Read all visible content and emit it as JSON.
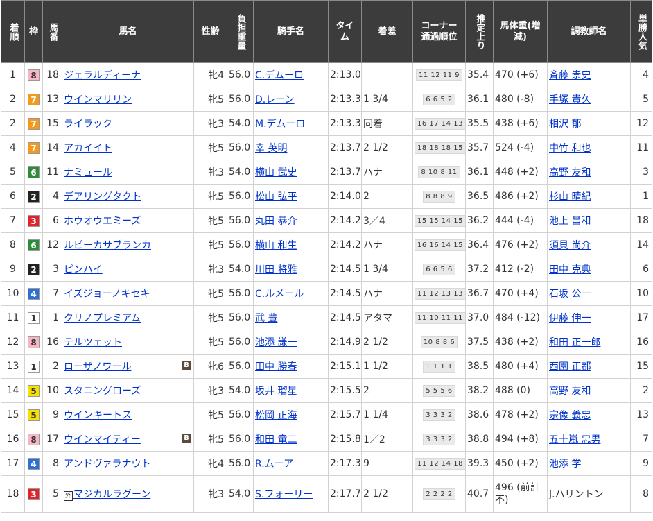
{
  "headers": {
    "rank": "着順",
    "waku": "枠",
    "umaban": "馬番",
    "horse": "馬名",
    "sexage": "性齢",
    "weight": "負担重量",
    "jockey": "騎手名",
    "time": "タイム",
    "margin": "着差",
    "corner": "コーナー通過順位",
    "last3f": "推定上り",
    "bodyweight": "馬体重(増減)",
    "trainer": "調教師名",
    "popularity": "単勝人気"
  },
  "waku_colors": {
    "1": {
      "bg": "#ffffff",
      "fg": "#333333"
    },
    "2": {
      "bg": "#222222",
      "fg": "#ffffff"
    },
    "3": {
      "bg": "#e0242a",
      "fg": "#ffffff"
    },
    "4": {
      "bg": "#2c6fd6",
      "fg": "#ffffff"
    },
    "5": {
      "bg": "#f5e000",
      "fg": "#333333"
    },
    "6": {
      "bg": "#2e8b3a",
      "fg": "#ffffff"
    },
    "7": {
      "bg": "#f39a1e",
      "fg": "#ffffff"
    },
    "8": {
      "bg": "#f6b6c6",
      "fg": "#333333"
    }
  },
  "rows": [
    {
      "rank": "1",
      "waku": "8",
      "umaban": "18",
      "horse": "ジェラルディーナ",
      "blinker": false,
      "ext": false,
      "sexage": "牝4",
      "weight": "56.0",
      "jockey": "C.デムーロ",
      "time": "2:13.0",
      "margin": "",
      "corner": "11 12 11 9",
      "last3f": "35.4",
      "bodyweight": "470 (+6)",
      "trainer": "斉藤 崇史",
      "trainer_link": true,
      "popularity": "4"
    },
    {
      "rank": "2",
      "waku": "7",
      "umaban": "13",
      "horse": "ウインマリリン",
      "blinker": false,
      "ext": false,
      "sexage": "牝5",
      "weight": "56.0",
      "jockey": "D.レーン",
      "time": "2:13.3",
      "margin": "1 3/4",
      "corner": "6 6 5 2",
      "last3f": "36.1",
      "bodyweight": "480 (-8)",
      "trainer": "手塚 貴久",
      "trainer_link": true,
      "popularity": "5"
    },
    {
      "rank": "2",
      "waku": "7",
      "umaban": "15",
      "horse": "ライラック",
      "blinker": false,
      "ext": false,
      "sexage": "牝3",
      "weight": "54.0",
      "jockey": "M.デムーロ",
      "time": "2:13.3",
      "margin": "同着",
      "corner": "16 17 14 13",
      "last3f": "35.5",
      "bodyweight": "438 (+6)",
      "trainer": "相沢 郁",
      "trainer_link": true,
      "popularity": "12"
    },
    {
      "rank": "4",
      "waku": "7",
      "umaban": "14",
      "horse": "アカイイト",
      "blinker": false,
      "ext": false,
      "sexage": "牝5",
      "weight": "56.0",
      "jockey": "幸 英明",
      "time": "2:13.7",
      "margin": "2 1/2",
      "corner": "18 18 18 15",
      "last3f": "35.7",
      "bodyweight": "524 (-4)",
      "trainer": "中竹 和也",
      "trainer_link": true,
      "popularity": "11"
    },
    {
      "rank": "5",
      "waku": "6",
      "umaban": "11",
      "horse": "ナミュール",
      "blinker": false,
      "ext": false,
      "sexage": "牝3",
      "weight": "54.0",
      "jockey": "横山 武史",
      "time": "2:13.7",
      "margin": "ハナ",
      "corner": "8 10 8 11",
      "last3f": "36.1",
      "bodyweight": "448 (+2)",
      "trainer": "高野 友和",
      "trainer_link": true,
      "popularity": "3"
    },
    {
      "rank": "6",
      "waku": "2",
      "umaban": "4",
      "horse": "デアリングタクト",
      "blinker": false,
      "ext": false,
      "sexage": "牝5",
      "weight": "56.0",
      "jockey": "松山 弘平",
      "time": "2:14.0",
      "margin": "2",
      "corner": "8 8 8 9",
      "last3f": "36.5",
      "bodyweight": "486 (+2)",
      "trainer": "杉山 晴紀",
      "trainer_link": true,
      "popularity": "1"
    },
    {
      "rank": "7",
      "waku": "3",
      "umaban": "6",
      "horse": "ホウオウエミーズ",
      "blinker": false,
      "ext": false,
      "sexage": "牝5",
      "weight": "56.0",
      "jockey": "丸田 恭介",
      "time": "2:14.2",
      "margin": "3／4",
      "corner": "15 15 14 15",
      "last3f": "36.2",
      "bodyweight": "444 (-4)",
      "trainer": "池上 昌和",
      "trainer_link": true,
      "popularity": "18"
    },
    {
      "rank": "8",
      "waku": "6",
      "umaban": "12",
      "horse": "ルビーカサブランカ",
      "blinker": false,
      "ext": false,
      "sexage": "牝5",
      "weight": "56.0",
      "jockey": "横山 和生",
      "time": "2:14.2",
      "margin": "ハナ",
      "corner": "16 16 14 15",
      "last3f": "36.4",
      "bodyweight": "476 (+2)",
      "trainer": "須貝 尚介",
      "trainer_link": true,
      "popularity": "14"
    },
    {
      "rank": "9",
      "waku": "2",
      "umaban": "3",
      "horse": "ピンハイ",
      "blinker": false,
      "ext": false,
      "sexage": "牝3",
      "weight": "54.0",
      "jockey": "川田 将雅",
      "time": "2:14.5",
      "margin": "1 3/4",
      "corner": "6 6 5 6",
      "last3f": "37.2",
      "bodyweight": "412 (-2)",
      "trainer": "田中 克典",
      "trainer_link": true,
      "popularity": "6"
    },
    {
      "rank": "10",
      "waku": "4",
      "umaban": "7",
      "horse": "イズジョーノキセキ",
      "blinker": false,
      "ext": false,
      "sexage": "牝5",
      "weight": "56.0",
      "jockey": "C.ルメール",
      "time": "2:14.5",
      "margin": "ハナ",
      "corner": "11 12 13 13",
      "last3f": "36.7",
      "bodyweight": "470 (+4)",
      "trainer": "石坂 公一",
      "trainer_link": true,
      "popularity": "10"
    },
    {
      "rank": "11",
      "waku": "1",
      "umaban": "1",
      "horse": "クリノプレミアム",
      "blinker": false,
      "ext": false,
      "sexage": "牝5",
      "weight": "56.0",
      "jockey": "武 豊",
      "time": "2:14.5",
      "margin": "アタマ",
      "corner": "11 10 11 11",
      "last3f": "37.0",
      "bodyweight": "484 (-12)",
      "trainer": "伊藤 伸一",
      "trainer_link": true,
      "popularity": "17"
    },
    {
      "rank": "12",
      "waku": "8",
      "umaban": "16",
      "horse": "テルツェット",
      "blinker": false,
      "ext": false,
      "sexage": "牝5",
      "weight": "56.0",
      "jockey": "池添 謙一",
      "time": "2:14.9",
      "margin": "2 1/2",
      "corner": "10 8 8 6",
      "last3f": "37.5",
      "bodyweight": "438 (+2)",
      "trainer": "和田 正一郎",
      "trainer_link": true,
      "popularity": "16"
    },
    {
      "rank": "13",
      "waku": "1",
      "umaban": "2",
      "horse": "ローザノワール",
      "blinker": true,
      "ext": false,
      "sexage": "牝6",
      "weight": "56.0",
      "jockey": "田中 勝春",
      "time": "2:15.1",
      "margin": "1 1/2",
      "corner": "1 1 1 1",
      "last3f": "38.5",
      "bodyweight": "480 (+4)",
      "trainer": "西園 正都",
      "trainer_link": true,
      "popularity": "15"
    },
    {
      "rank": "14",
      "waku": "5",
      "umaban": "10",
      "horse": "スタニングローズ",
      "blinker": false,
      "ext": false,
      "sexage": "牝3",
      "weight": "54.0",
      "jockey": "坂井 瑠星",
      "time": "2:15.5",
      "margin": "2",
      "corner": "5 5 5 6",
      "last3f": "38.2",
      "bodyweight": "488 (0)",
      "trainer": "高野 友和",
      "trainer_link": true,
      "popularity": "2"
    },
    {
      "rank": "15",
      "waku": "5",
      "umaban": "9",
      "horse": "ウインキートス",
      "blinker": false,
      "ext": false,
      "sexage": "牝5",
      "weight": "56.0",
      "jockey": "松岡 正海",
      "time": "2:15.7",
      "margin": "1 1/4",
      "corner": "3 3 3 2",
      "last3f": "38.6",
      "bodyweight": "478 (+2)",
      "trainer": "宗像 義忠",
      "trainer_link": true,
      "popularity": "13"
    },
    {
      "rank": "16",
      "waku": "8",
      "umaban": "17",
      "horse": "ウインマイティー",
      "blinker": true,
      "ext": false,
      "sexage": "牝5",
      "weight": "56.0",
      "jockey": "和田 竜二",
      "time": "2:15.8",
      "margin": "1／2",
      "corner": "3 3 3 2",
      "last3f": "38.8",
      "bodyweight": "494 (+8)",
      "trainer": "五十嵐 忠男",
      "trainer_link": true,
      "popularity": "7"
    },
    {
      "rank": "17",
      "waku": "4",
      "umaban": "8",
      "horse": "アンドヴァラナウト",
      "blinker": false,
      "ext": false,
      "sexage": "牝4",
      "weight": "56.0",
      "jockey": "R.ムーア",
      "time": "2:17.3",
      "margin": "9",
      "corner": "11 12 14 18",
      "last3f": "39.3",
      "bodyweight": "450 (+2)",
      "trainer": "池添 学",
      "trainer_link": true,
      "popularity": "9"
    },
    {
      "rank": "18",
      "waku": "3",
      "umaban": "5",
      "horse": "マジカルラグーン",
      "blinker": false,
      "ext": true,
      "ext_label": "外",
      "sexage": "牝3",
      "weight": "54.0",
      "jockey": "S.フォーリー",
      "time": "2:17.7",
      "margin": "2 1/2",
      "corner": "2 2 2 2",
      "last3f": "40.7",
      "bodyweight": "496 (前計不)",
      "trainer": "J.ハリントン",
      "trainer_link": false,
      "popularity": "8"
    }
  ],
  "blinker_label": "B"
}
